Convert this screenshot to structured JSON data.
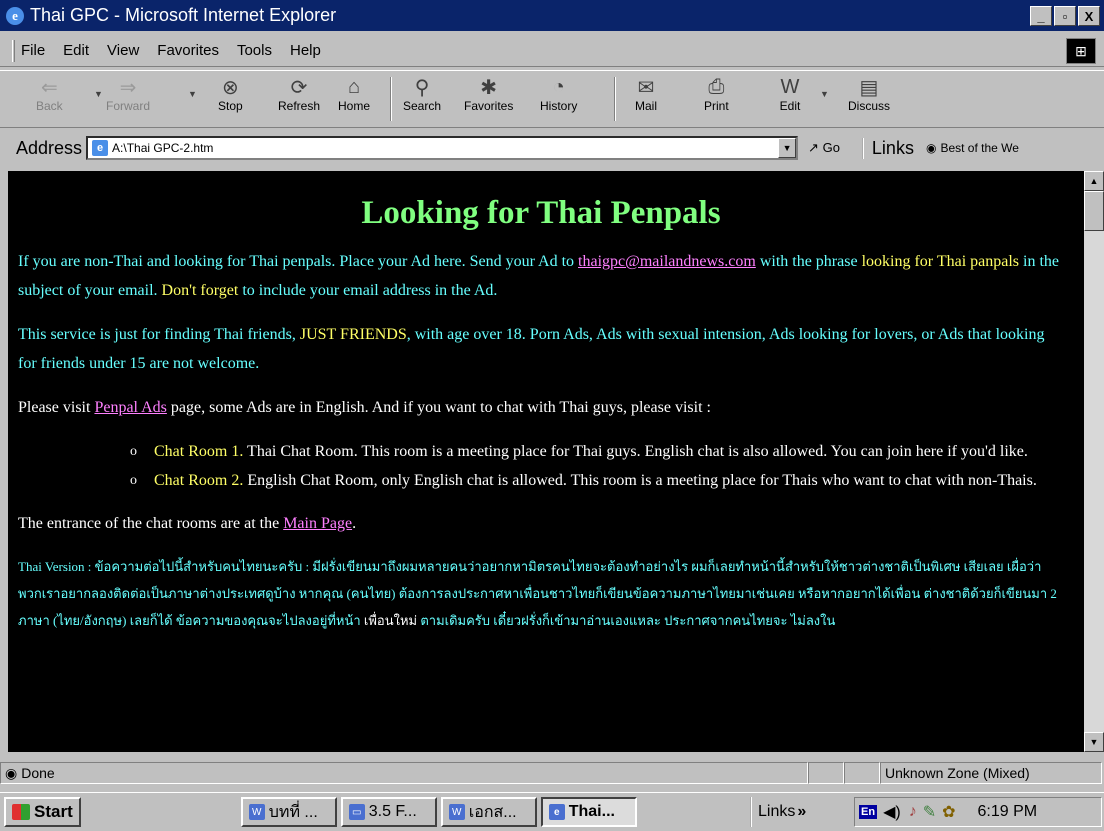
{
  "window": {
    "title": "Thai GPC - Microsoft Internet Explorer",
    "min": "_",
    "max": "▫",
    "close": "X"
  },
  "menu": [
    "File",
    "Edit",
    "View",
    "Favorites",
    "Tools",
    "Help"
  ],
  "toolbar": {
    "back": "Back",
    "forward": "Forward",
    "stop": "Stop",
    "refresh": "Refresh",
    "home": "Home",
    "search": "Search",
    "favorites": "Favorites",
    "history": "History",
    "mail": "Mail",
    "print": "Print",
    "edit": "Edit",
    "discuss": "Discuss"
  },
  "address": {
    "label": "Address",
    "url": "A:\\Thai GPC-2.htm",
    "go": "Go",
    "links": "Links",
    "best": "Best of the We"
  },
  "page": {
    "title": "Looking for Thai Penpals",
    "p1_a": "If you are non-Thai and looking for Thai penpals. Place your Ad here. Send your Ad to ",
    "p1_link": "thaigpc@mailandnews.com",
    "p1_b": " with the phrase ",
    "p1_hl1": "looking for Thai panpals",
    "p1_c": " in the subject of your email. ",
    "p1_hl2": "Don't forget",
    "p1_d": " to include your email address in the Ad.",
    "p2_a": "This service is just for finding Thai friends, ",
    "p2_hl": "JUST FRIENDS",
    "p2_b": ", with age over 18. Porn Ads, Ads with sexual intension, Ads looking for lovers, or Ads that looking for friends under 15 are not welcome.",
    "p3_a": "Please visit ",
    "p3_link": "Penpal Ads",
    "p3_b": " page, some Ads are in English. And if you want to chat with Thai guys, please visit :",
    "rooms": [
      {
        "name": "Chat Room 1.",
        "desc": " Thai Chat Room. This room is a meeting place for Thai guys. English chat is also allowed. You can join here if you'd like."
      },
      {
        "name": "Chat Room 2.",
        "desc": " English Chat Room, only English chat is allowed. This room is a meeting place for Thais who want to chat with non-Thais."
      }
    ],
    "p4_a": "The entrance of the chat rooms are at the ",
    "p4_link": "Main Page",
    "p4_b": ".",
    "thai_a": "Thai Version : ข้อความต่อไปนี้สำหรับคนไทยนะครับ : มีฝรั่งเขียนมาถึงผมหลายคนว่าอยากหามิตรคนไทยจะต้องทำอย่างไร ผมก็เลยทำหน้านี้สำหรับให้ชาวต่างชาติเป็นพิเศษ เสียเลย เผื่อว่าพวกเราอยากลองติดต่อเป็นภาษาต่างประเทศดูบ้าง หากคุณ (คนไทย) ต้องการลงประกาศหาเพื่อนชาวไทยก็เขียนข้อความภาษาไทยมาเช่นเคย หรือหากอยากได้เพื่อน ต่างชาติด้วยก็เขียนมา 2 ภาษา (ไทย/อังกฤษ) เลยก็ได้ ข้อความของคุณจะไปลงอยู่ที่หน้า ",
    "thai_w": "เพื่อนใหม่",
    "thai_b": " ตามเดิมครับ เดี๋ยวฝรั่งก็เข้ามาอ่านเองแหละ ประกาศจากคนไทยจะ ไม่ลงใน"
  },
  "status": {
    "text": "Done",
    "zone": "Unknown Zone (Mixed)"
  },
  "taskbar": {
    "start": "Start",
    "tasks": [
      "บทที่ ...",
      "3.5 F...",
      "เอกส...",
      "Thai..."
    ],
    "links": "Links",
    "lang": "En",
    "clock": "6:19 PM"
  }
}
